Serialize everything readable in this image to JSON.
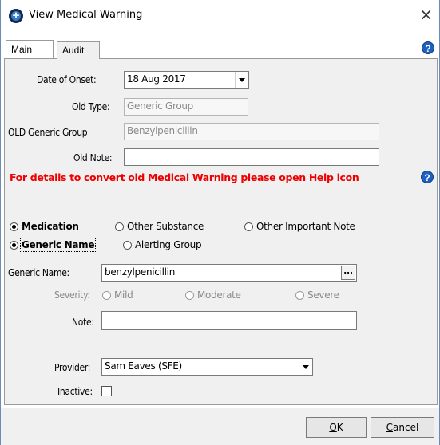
{
  "window": {
    "title": "View Medical Warning",
    "close_glyph": "×"
  },
  "tabs": [
    {
      "label": "Main",
      "active": true
    },
    {
      "label": "Audit",
      "active": false
    }
  ],
  "form": {
    "date_of_onset_label": "Date of Onset:",
    "date_of_onset_value": "18 Aug 2017",
    "old_type_label": "Old Type:",
    "old_type_value": "Generic Group",
    "old_generic_group_label": "OLD Generic Group",
    "old_generic_group_value": "Benzylpenicillin",
    "old_note_label": "Old Note:",
    "old_note_value": "",
    "warning_text": "For details to convert old Medical Warning please open Help icon",
    "category_options": [
      "Medication",
      "Other Substance",
      "Other Important Note"
    ],
    "category_selected": "Medication",
    "lookup_options": [
      "Generic Name",
      "Alerting Group"
    ],
    "lookup_selected": "Generic Name",
    "generic_name_label": "Generic Name:",
    "generic_name_value": "benzylpenicillin",
    "ellipsis": "...",
    "severity_label": "Severity:",
    "severity_options": [
      "Mild",
      "Moderate",
      "Severe"
    ],
    "note_label": "Note:",
    "note_value": "",
    "provider_label": "Provider:",
    "provider_value": "Sam Eaves (SFE)",
    "inactive_label": "Inactive:",
    "inactive_checked": false
  },
  "buttons": {
    "ok_label": "K",
    "ok_mnemonic": "O",
    "cancel_label": "ancel",
    "cancel_mnemonic": "C"
  },
  "icons": {
    "help": "?",
    "app": "plus-circle-icon"
  },
  "colors": {
    "warning_red": "#ee0000",
    "help_blue": "#1f5fbf",
    "panel_bg": "#f0f0f0"
  }
}
